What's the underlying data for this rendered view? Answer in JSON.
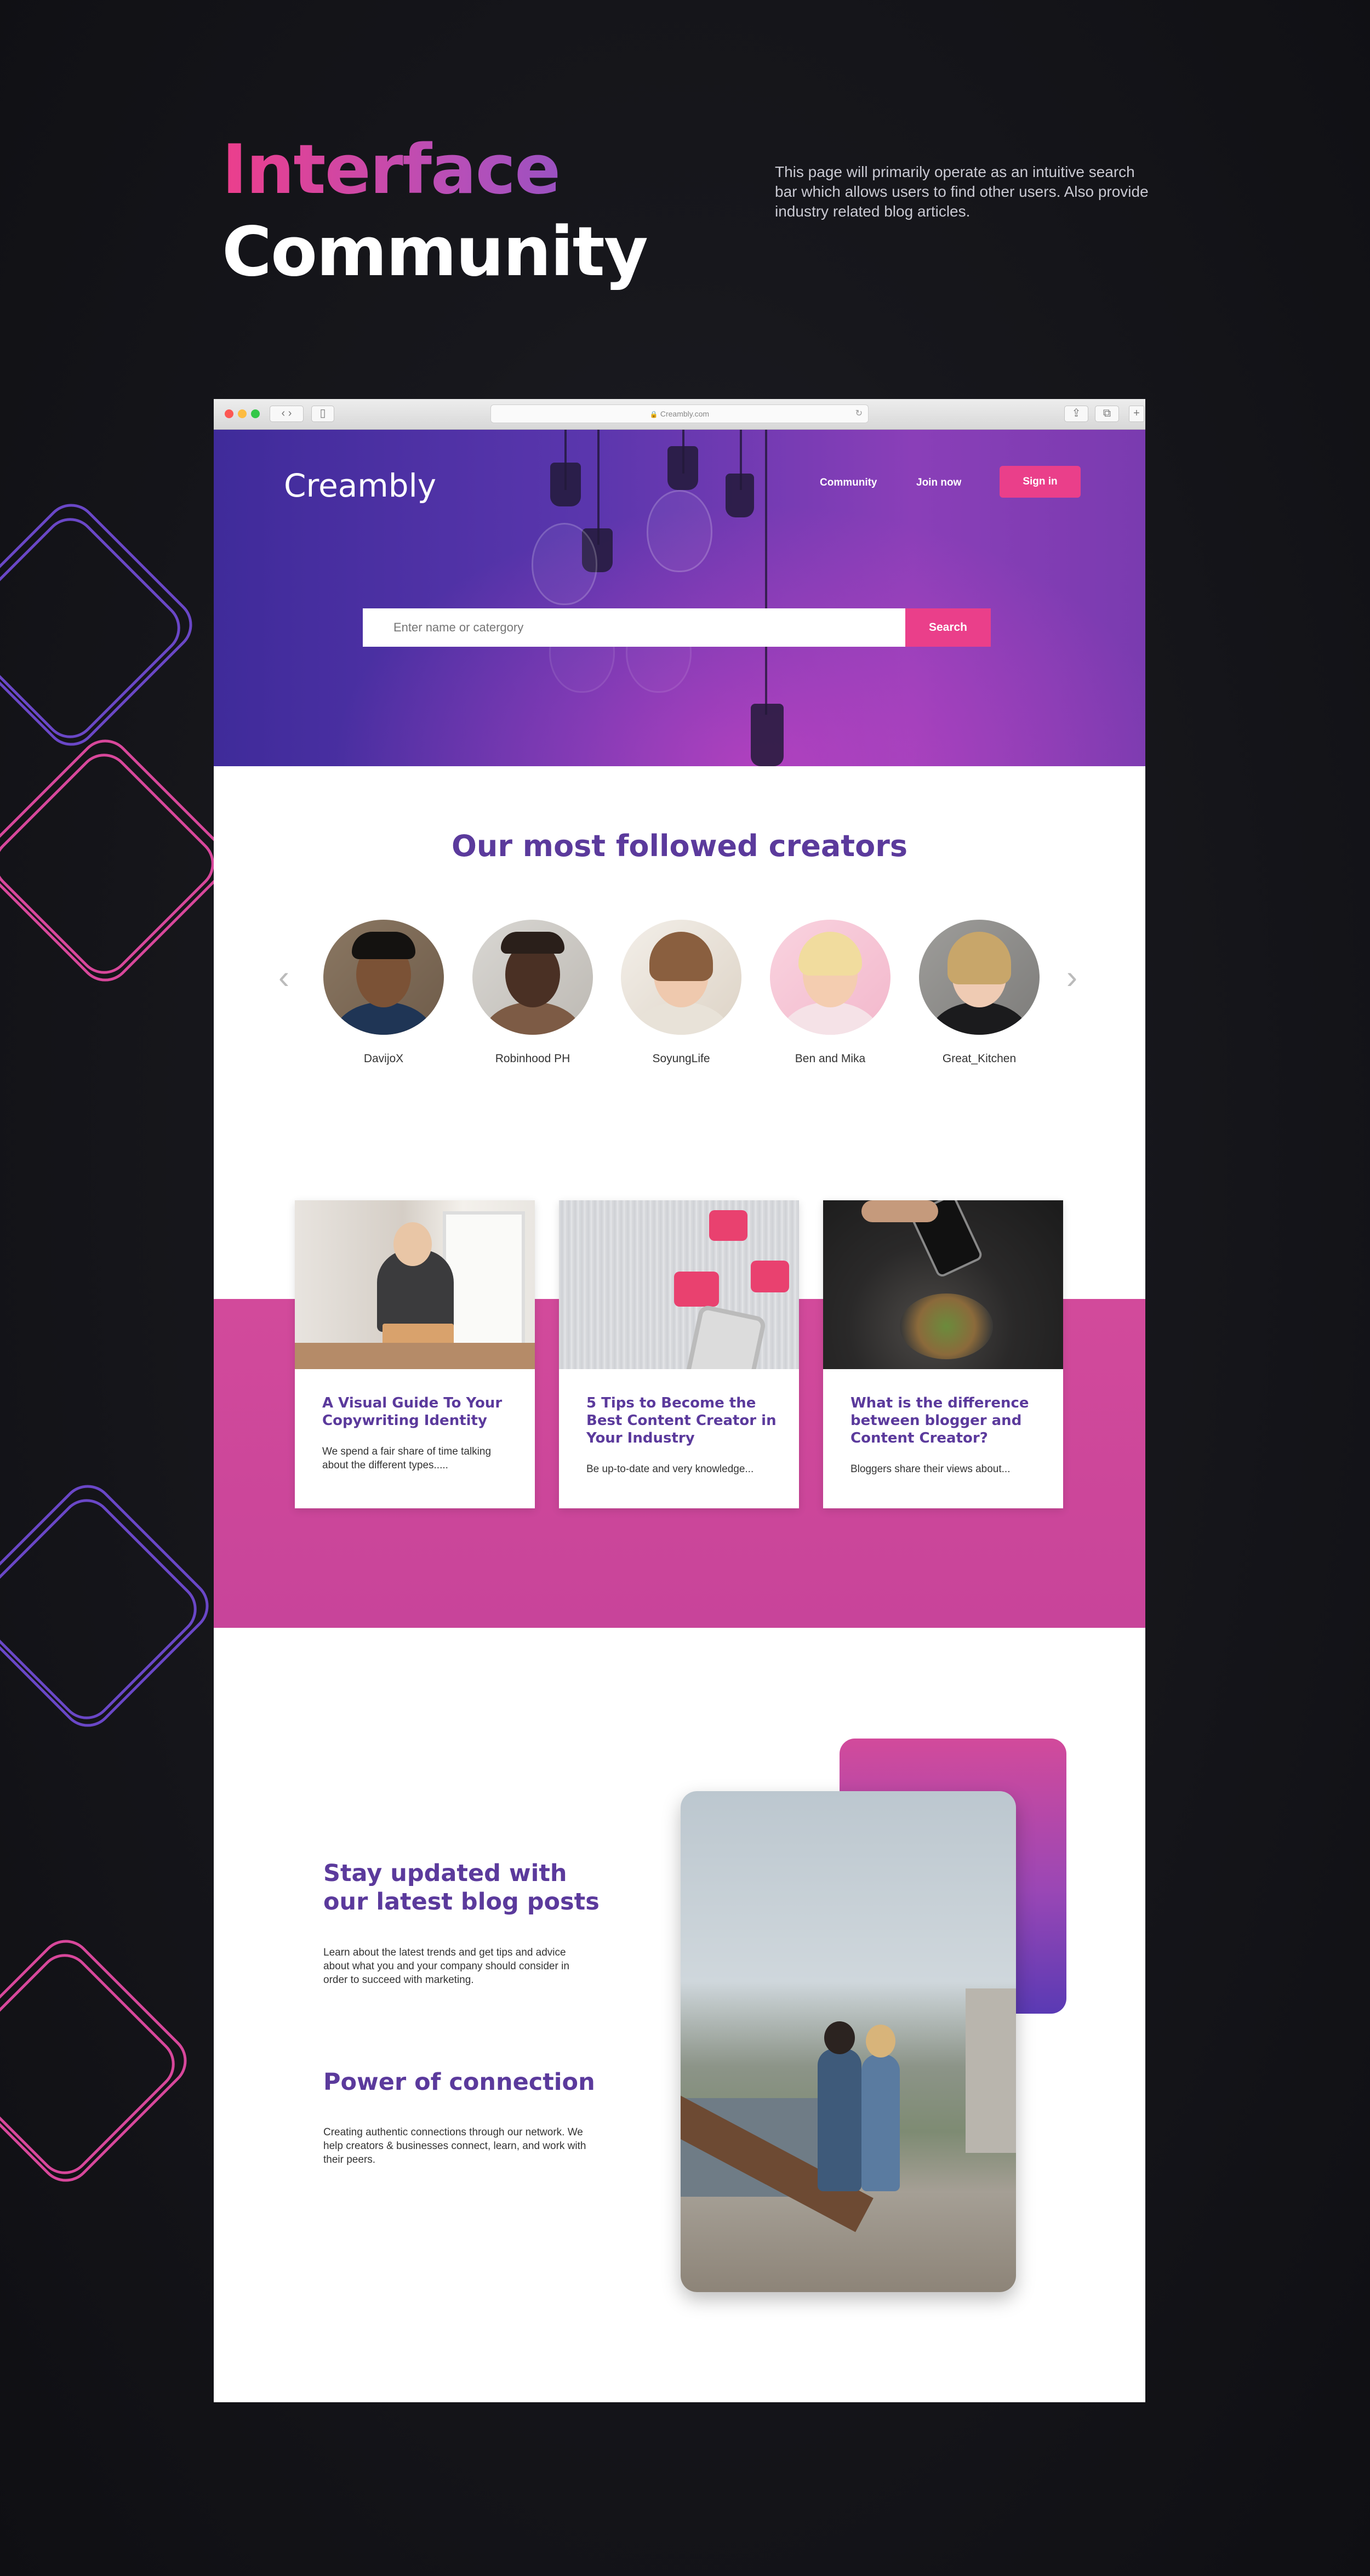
{
  "presentation": {
    "title_line1": "Interface",
    "title_line2": "Community",
    "description": "This page will primarily operate as an intuitive search bar which allows users to find other users. Also provide industry related blog articles."
  },
  "browser": {
    "url": "Creambly.com"
  },
  "header": {
    "logo": "Creambly",
    "nav": {
      "community": "Community",
      "join_now": "Join now",
      "sign_in": "Sign in"
    }
  },
  "search": {
    "placeholder": "Enter name or catergory",
    "button_label": "Search"
  },
  "creators": {
    "title": "Our most followed creators",
    "items": [
      {
        "name": "DavijoX"
      },
      {
        "name": "Robinhood PH"
      },
      {
        "name": "SoyungLife"
      },
      {
        "name": "Ben and Mika"
      },
      {
        "name": "Great_Kitchen"
      }
    ]
  },
  "articles": [
    {
      "title": "A Visual Guide To Your Copywriting Identity",
      "excerpt": "We spend a fair share of time talking about the different types....."
    },
    {
      "title": "5 Tips to Become the Best Content Creator in Your Industry",
      "excerpt": "Be up-to-date and very knowledge..."
    },
    {
      "title": "What is the difference between blogger and Content Creator?",
      "excerpt": "Bloggers share their views about..."
    }
  ],
  "features": [
    {
      "title": "Stay updated with our latest blog posts",
      "text": "Learn about the latest trends and get tips and advice about what you and your company should consider in order to succeed with marketing."
    },
    {
      "title": "Power of connection",
      "text": "Creating authentic connections through our network. We help creators & businesses connect, learn, and work with their peers."
    }
  ],
  "colors": {
    "accent_pink": "#ea3f8a",
    "brand_purple": "#5b3a9c",
    "hero_purple": "#5a36ad"
  }
}
